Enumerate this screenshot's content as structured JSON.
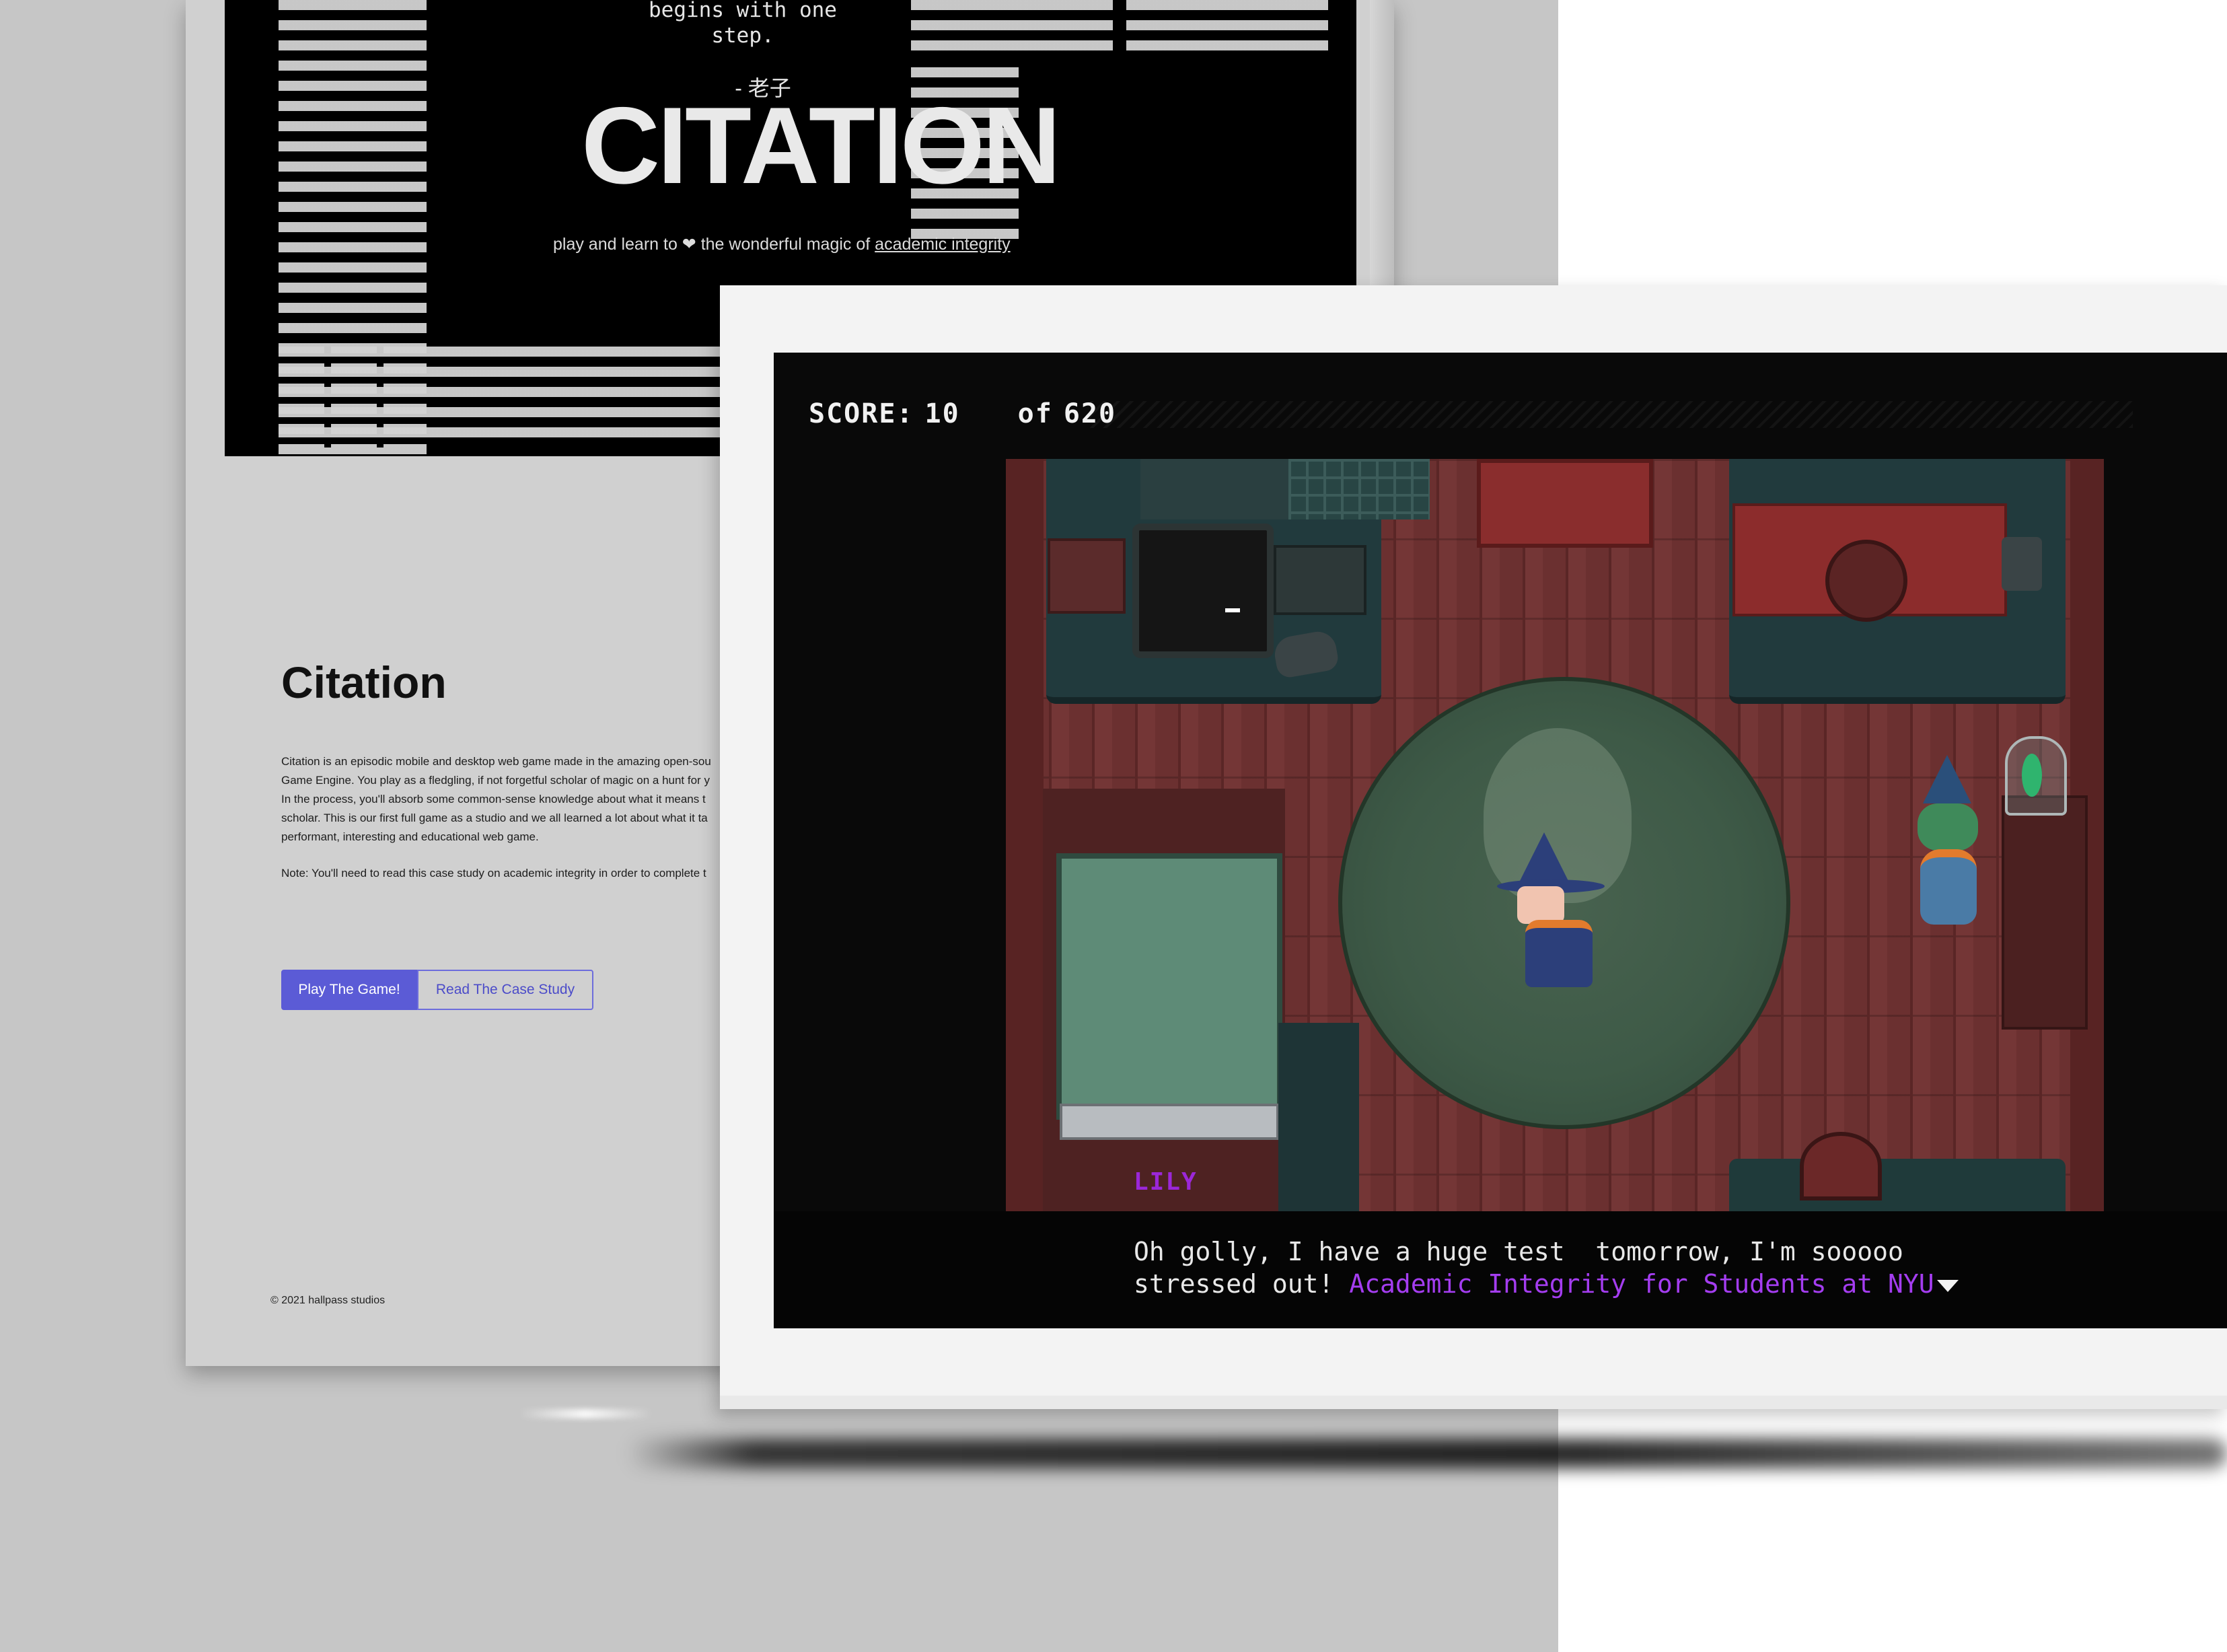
{
  "website": {
    "hero": {
      "quote": "begins with one\nstep.",
      "author": "- 老子",
      "title": "CITATION",
      "tagline_prefix": "play and learn to ❤ the wonderful magic of",
      "tagline_link": "academic integrity"
    },
    "heading": "Citation",
    "description_lines": [
      "Citation is an episodic mobile and desktop web game made in the amazing open-sou",
      "Game Engine. You play as a fledgling, if not forgetful scholar of magic on a hunt for y",
      "In the process, you'll absorb some common-sense knowledge about what it means t",
      "scholar. This is our first full game as a studio and we all learned a lot about what it ta",
      "performant, interesting and educational web game."
    ],
    "description_link": "Game Engine",
    "note": "Note: You'll need to read this case study on academic integrity in order to complete t",
    "buttons": {
      "play": "Play The Game!",
      "case_study": "Read The Case Study"
    },
    "footer": "© 2021 hallpass studios"
  },
  "game": {
    "hud": {
      "score_label": "SCORE:",
      "score": "10",
      "of_label": "of",
      "total": "620"
    },
    "bed_label": "LILY",
    "dialog": {
      "line1": "Oh golly, I have a huge test  tomorrow, I'm sooooo",
      "line2_prefix": "stressed out! ",
      "line2_link": "Academic Integrity for Students at NYU"
    }
  },
  "colors": {
    "accent": "#5b5bd6",
    "dialog_link": "#a43df0",
    "bed_label": "#9b27d8"
  }
}
